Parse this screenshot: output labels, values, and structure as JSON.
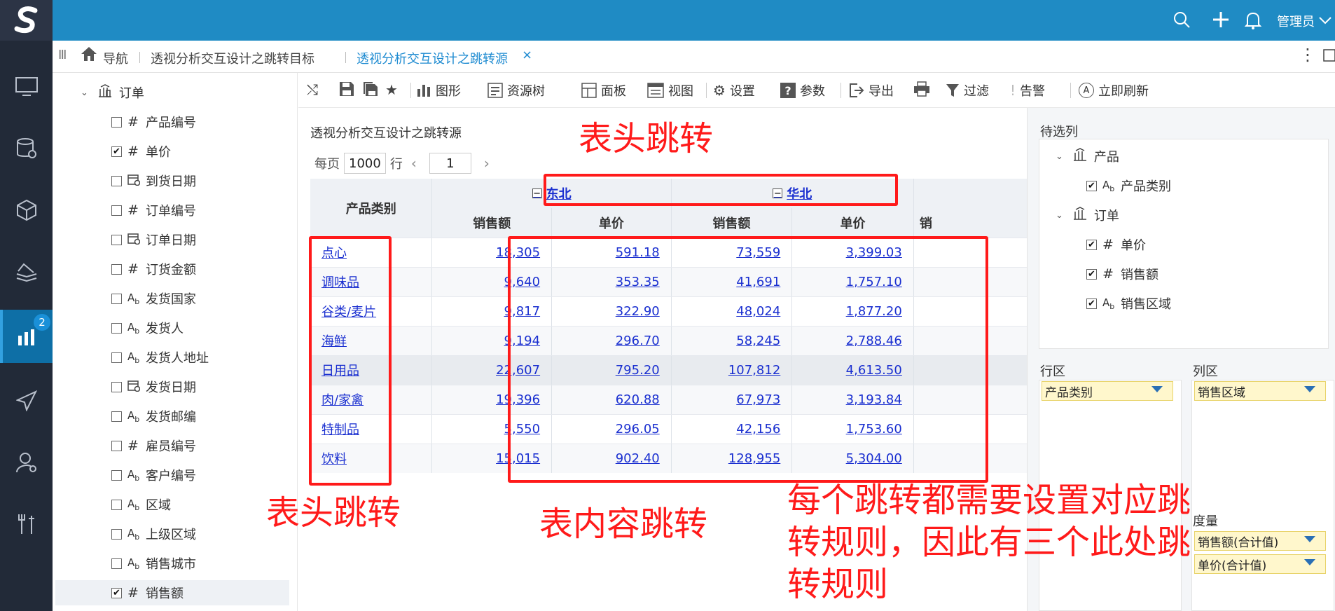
{
  "rail": {
    "badge": "2"
  },
  "topbar": {
    "user": "管理员"
  },
  "tabs": {
    "nav": "导航",
    "target": "透视分析交互设计之跳转目标",
    "source": "透视分析交互设计之跳转源",
    "close": "×"
  },
  "tree": {
    "root": "订单",
    "fields": [
      {
        "label": "产品编号",
        "type": "#",
        "checked": false
      },
      {
        "label": "单价",
        "type": "#",
        "checked": true
      },
      {
        "label": "到货日期",
        "type": "date",
        "checked": false
      },
      {
        "label": "订单编号",
        "type": "#",
        "checked": false
      },
      {
        "label": "订单日期",
        "type": "date",
        "checked": false
      },
      {
        "label": "订货金额",
        "type": "#",
        "checked": false
      },
      {
        "label": "发货国家",
        "type": "Ab",
        "checked": false
      },
      {
        "label": "发货人",
        "type": "Ab",
        "checked": false
      },
      {
        "label": "发货人地址",
        "type": "Ab",
        "checked": false
      },
      {
        "label": "发货日期",
        "type": "date",
        "checked": false
      },
      {
        "label": "发货邮编",
        "type": "Ab",
        "checked": false
      },
      {
        "label": "雇员编号",
        "type": "#",
        "checked": false
      },
      {
        "label": "客户编号",
        "type": "Ab",
        "checked": false
      },
      {
        "label": "区域",
        "type": "Ab",
        "checked": false
      },
      {
        "label": "上级区域",
        "type": "Ab",
        "checked": false
      },
      {
        "label": "销售城市",
        "type": "Ab",
        "checked": false
      },
      {
        "label": "销售额",
        "type": "#",
        "checked": true
      }
    ]
  },
  "toolbar": {
    "chart": "图形",
    "restree": "资源树",
    "panel": "面板",
    "view": "视图",
    "settings": "设置",
    "params": "参数",
    "export": "导出",
    "filter": "过滤",
    "alarm": "告警",
    "refresh": "立即刷新"
  },
  "report": {
    "title": "透视分析交互设计之跳转源",
    "pager": {
      "per_page": "每页",
      "size": "1000",
      "rows": "行",
      "page": "1"
    },
    "row_header": "产品类别",
    "regions": [
      "东北",
      "华北"
    ],
    "measures": [
      "销售额",
      "单价",
      "销售额",
      "单价",
      "销"
    ],
    "rows": [
      {
        "cat": "点心",
        "v": [
          "18,305",
          "591.18",
          "73,559",
          "3,399.03"
        ]
      },
      {
        "cat": "调味品",
        "v": [
          "9,640",
          "353.35",
          "41,691",
          "1,757.10"
        ]
      },
      {
        "cat": "谷类/麦片",
        "v": [
          "9,817",
          "322.90",
          "48,024",
          "1,877.20"
        ]
      },
      {
        "cat": "海鲜",
        "v": [
          "9,194",
          "296.70",
          "58,245",
          "2,788.46"
        ]
      },
      {
        "cat": "日用品",
        "v": [
          "22,607",
          "795.20",
          "107,812",
          "4,613.50"
        ]
      },
      {
        "cat": "肉/家禽",
        "v": [
          "19,396",
          "620.88",
          "67,973",
          "3,193.84"
        ]
      },
      {
        "cat": "特制品",
        "v": [
          "5,550",
          "296.05",
          "42,156",
          "1,753.60"
        ]
      },
      {
        "cat": "饮料",
        "v": [
          "15,015",
          "902.40",
          "128,955",
          "5,304.00"
        ]
      }
    ]
  },
  "rpanel": {
    "pending": "待选列",
    "product": "产品",
    "product_cat": "产品类别",
    "order": "订单",
    "unit_price": "单价",
    "sales": "销售额",
    "sales_region": "销售区域",
    "row_zone": "行区",
    "col_zone": "列区",
    "measure_zone": "度量",
    "row_pill": "产品类别",
    "col_pill": "销售区域",
    "measure_pill1": "销售额(合计值)",
    "measure_pill2": "单价(合计值)"
  },
  "annotations": {
    "header_jump_top": "表头跳转",
    "header_jump_left": "表头跳转",
    "content_jump": "表内容跳转",
    "note_l1": "每个跳转都需要设置对应跳",
    "note_l2": "转规则，因此有三个此处跳",
    "note_l3": "转规则",
    "color": "#ff1a1a"
  }
}
